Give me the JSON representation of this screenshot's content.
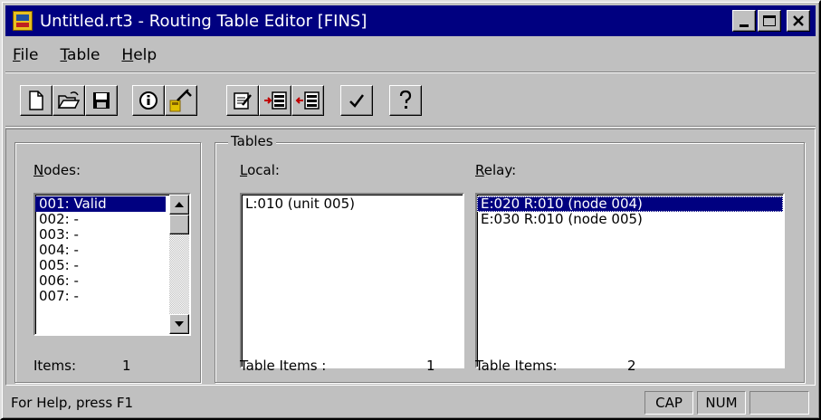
{
  "window": {
    "title": "Untitled.rt3 - Routing Table Editor [FINS]",
    "icon": "routing-table-editor-app-icon"
  },
  "menu": [
    {
      "label": "File",
      "accel": "F",
      "rest": "ile"
    },
    {
      "label": "Table",
      "accel": "T",
      "rest": "able"
    },
    {
      "label": "Help",
      "accel": "H",
      "rest": "elp"
    }
  ],
  "toolbar": {
    "buttons": [
      "new-file-icon",
      "open-folder-icon",
      "save-disk-icon",
      "info-icon",
      "routing-wizard-icon",
      "edit-table-icon",
      "add-local-icon",
      "add-relay-icon",
      "check-icon",
      "help-icon"
    ]
  },
  "nodes": {
    "label_accel": "N",
    "label_rest": "odes:",
    "items": [
      "001: Valid",
      "002: -",
      "003: -",
      "004: -",
      "005: -",
      "006: -",
      "007: -"
    ],
    "selected_index": 0,
    "count_label": "Items:",
    "count": "1"
  },
  "tables": {
    "legend": "Tables",
    "local": {
      "label_accel": "L",
      "label_rest": "ocal:",
      "items": [
        "L:010  (unit 005)"
      ],
      "count_label": "Table Items :",
      "count": "1"
    },
    "relay": {
      "label_accel": "R",
      "label_rest": "elay:",
      "items": [
        "E:020  R:010 (node 004)",
        "E:030  R:010 (node 005)"
      ],
      "selected_index": 0,
      "count_label": "Table Items:",
      "count": "2"
    }
  },
  "status": {
    "text": "For Help, press F1",
    "cap": "CAP",
    "num": "NUM",
    "scrl": ""
  },
  "colors": {
    "titlebar": "#000080",
    "face": "#c0c0c0",
    "selection": "#000080"
  }
}
